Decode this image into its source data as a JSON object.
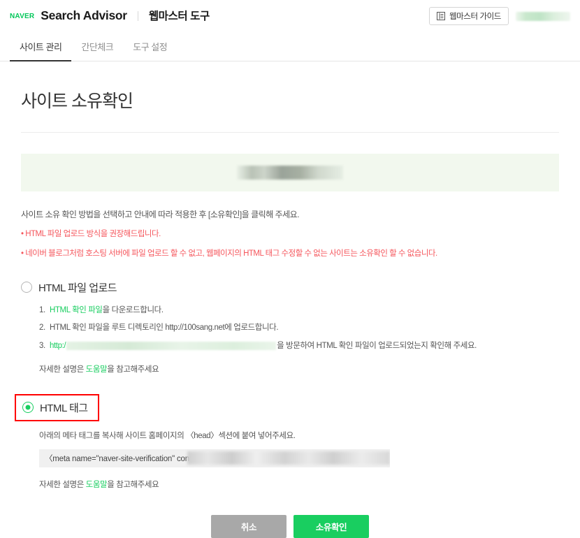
{
  "header": {
    "logo_text": "NAVER",
    "brand_title": "Search Advisor",
    "brand_sub": "웹마스터 도구",
    "guide_button": "웹마스터 가이드",
    "guide_icon": "book-icon",
    "user_account": "",
    "accent_green": "#19ce60",
    "naver_green": "#03c75a"
  },
  "tabs": [
    {
      "label": "사이트 관리",
      "active": true
    },
    {
      "label": "간단체크",
      "active": false
    },
    {
      "label": "도구 설정",
      "active": false
    }
  ],
  "page": {
    "title": "사이트 소유확인",
    "site_banner_value": "",
    "lead": "사이트 소유 확인 방법을 선택하고 안내에 따라 적용한 후 [소유확인]을 클릭해 주세요.",
    "notices": [
      "• HTML 파일 업로드 방식을 권장해드립니다.",
      "• 네이버 블로그처럼 호스팅 서버에 파일 업로드 할 수 없고, 웹페이지의 HTML 태그 수정할 수 없는 사이트는 소유확인 할 수 없습니다."
    ]
  },
  "option_file": {
    "label": "HTML 파일 업로드",
    "selected": false,
    "steps": [
      {
        "num": "1.",
        "link_text": "HTML 확인 파일",
        "text_after": "을 다운로드합니다."
      },
      {
        "num": "2.",
        "text": "HTML 확인 파일을 루트 디렉토리인 http://100sang.net에 업로드합니다."
      },
      {
        "num": "3.",
        "link_text": "http:/",
        "redacted": true,
        "text_after": "을 방문하여 HTML 확인 파일이 업로드되었는지 확인해 주세요."
      }
    ],
    "helper_prefix": "자세한 설명은 ",
    "helper_link": "도움말",
    "helper_suffix": "을 참고해주세요"
  },
  "option_tag": {
    "label": "HTML 태그",
    "selected": true,
    "highlight_color": "#ff0000",
    "description": "아래의 메타 태그를 복사해 사이트 홈페이지의 〈head〉섹션에 붙여 넣어주세요.",
    "meta_value": "〈meta name=\"naver-site-verification\" cont",
    "meta_redacted": true,
    "helper_prefix": "자세한 설명은 ",
    "helper_link": "도움말",
    "helper_suffix": "을 참고해주세요"
  },
  "footer": {
    "cancel_label": "취소",
    "submit_label": "소유확인"
  }
}
